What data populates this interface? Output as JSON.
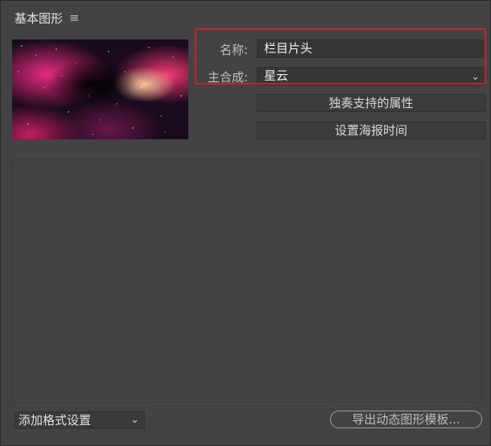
{
  "panel": {
    "title": "基本图形",
    "menu_icon": "hamburger-menu-icon"
  },
  "properties": {
    "name_label": "名称:",
    "name_value": "栏目片头",
    "composition_label": "主合成:",
    "composition_value": "星云"
  },
  "buttons": {
    "solo_supported": "独奏支持的属性",
    "set_poster_time": "设置海报时间",
    "add_format": "添加格式设置",
    "export_template": "导出动态图形模板..."
  },
  "colors": {
    "highlight": "#c0262b",
    "panel_bg": "#434343"
  }
}
